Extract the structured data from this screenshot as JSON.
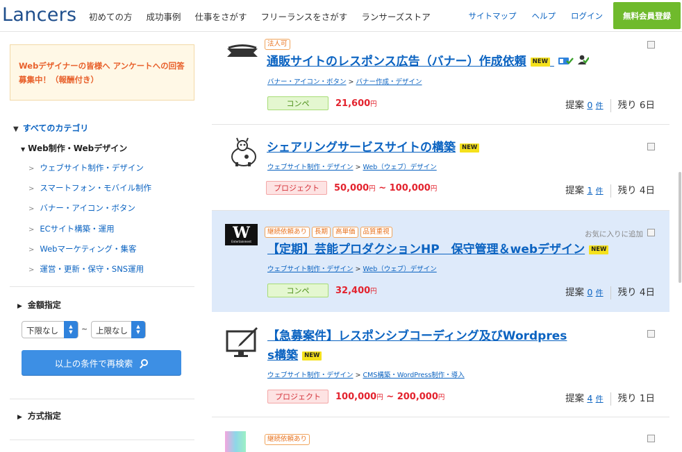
{
  "header": {
    "logo": "Lancers",
    "nav": [
      "初めての方",
      "成功事例",
      "仕事をさがす",
      "フリーランスをさがす",
      "ランサーズストア"
    ],
    "util": [
      "サイトマップ",
      "ヘルプ",
      "ログイン"
    ],
    "signup": "無料会員登録"
  },
  "sidebar": {
    "notice": "Webデザイナーの皆様へ アンケートへの回答募集中！（報酬付き）",
    "all_categories": "すべてのカテゴリ",
    "current_category": "Web制作・Webデザイン",
    "subcategories": [
      "ウェブサイト制作・デザイン",
      "スマートフォン・モバイル制作",
      "バナー・アイコン・ボタン",
      "ECサイト構築・運用",
      "Webマーケティング・集客",
      "運営・更新・保守・SNS運用"
    ],
    "price_section": "金額指定",
    "min_price": "下限なし",
    "max_price": "上限なし",
    "range_sep": "~",
    "search_button": "以上の条件で再検索",
    "method_section": "方式指定"
  },
  "jobs": [
    {
      "tags": [
        "法人可"
      ],
      "title": "通販サイトのレスポンス広告（バナー）作成依頼",
      "new": "NEW",
      "cat1": "バナー・アイコン・ボタン",
      "cat2": "バナー作成・デザイン",
      "type": "コンペ",
      "price": "21,600",
      "price_unit": "円",
      "proposals_label": "提案",
      "proposals": "0",
      "unit": "件",
      "remaining": "残り 6日"
    },
    {
      "tags": [],
      "title": "シェアリングサービスサイトの構築",
      "new": "NEW",
      "cat1": "ウェブサイト制作・デザイン",
      "cat2": "Web（ウェブ）デザイン",
      "type": "プロジェクト",
      "price": "50,000",
      "price_unit": "円",
      "price_sep": " ~ ",
      "price_max": "100,000",
      "proposals_label": "提案",
      "proposals": "1",
      "unit": "件",
      "remaining": "残り 4日"
    },
    {
      "tags": [
        "継続依頼あり",
        "長期",
        "高単価",
        "品質重視"
      ],
      "title": "【定期】芸能プロダクションHP　保守管理＆webデザイン",
      "new": "NEW",
      "cat1": "ウェブサイト制作・デザイン",
      "cat2": "Web（ウェブ）デザイン",
      "type": "コンペ",
      "price": "32,400",
      "price_unit": "円",
      "proposals_label": "提案",
      "proposals": "0",
      "unit": "件",
      "remaining": "残り 4日",
      "fav_label": "お気に入りに追加",
      "logo_letter": "W",
      "logo_sub": "Entertainment"
    },
    {
      "tags": [],
      "title_line1": "【急募案件】レスポンシブコーディング及びWordpres",
      "title_line2": "s構築",
      "new": "NEW",
      "cat1": "ウェブサイト制作・デザイン",
      "cat2": "CMS構築・WordPress制作・導入",
      "type": "プロジェクト",
      "price": "100,000",
      "price_unit": "円",
      "price_sep": " ~ ",
      "price_max": "200,000",
      "proposals_label": "提案",
      "proposals": "4",
      "unit": "件",
      "remaining": "残り 1日"
    },
    {
      "tags": [
        "継続依頼あり"
      ]
    }
  ],
  "colors": {
    "brand_blue": "#1e4e8c",
    "link": "#0b63c1",
    "signup_green": "#6fba2c",
    "price_red": "#e3232e",
    "highlight_row": "#deeafa"
  }
}
